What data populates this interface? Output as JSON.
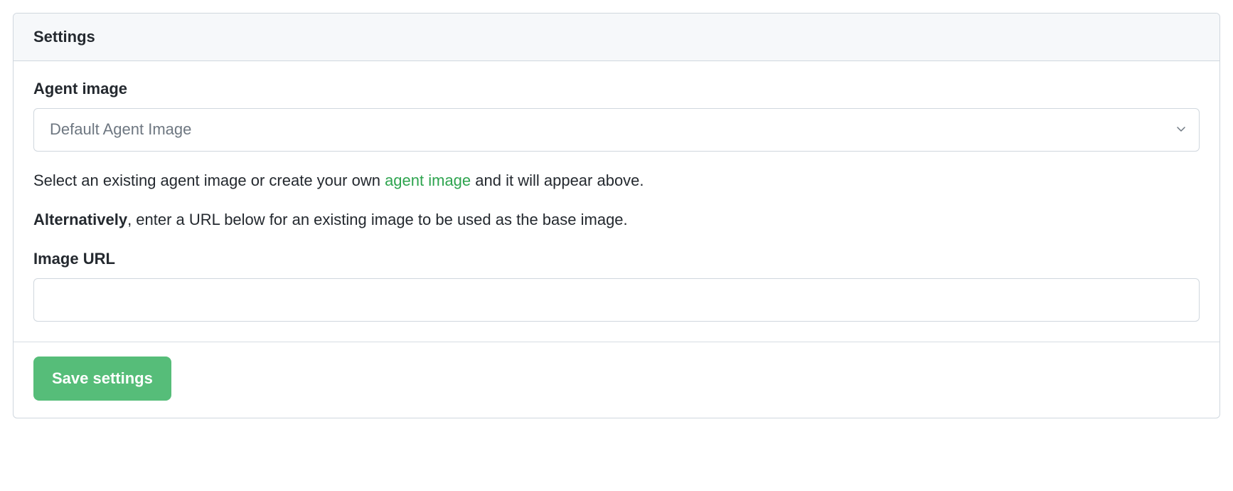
{
  "card": {
    "title": "Settings"
  },
  "form": {
    "agent_image": {
      "label": "Agent image",
      "selected": "Default Agent Image"
    },
    "help": {
      "prefix": "Select an existing agent image or create your own ",
      "link_text": "agent image",
      "suffix": " and it will appear above."
    },
    "alt": {
      "bold": "Alternatively",
      "rest": ", enter a URL below for an existing image to be used as the base image."
    },
    "image_url": {
      "label": "Image URL",
      "value": ""
    },
    "save_label": "Save settings"
  }
}
